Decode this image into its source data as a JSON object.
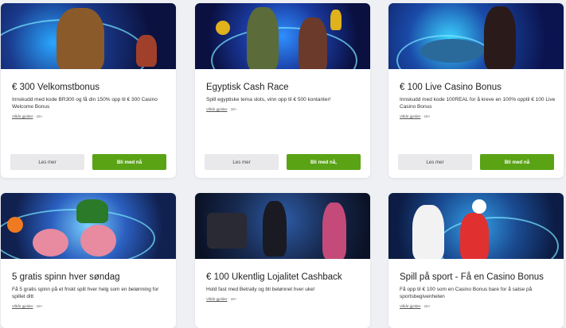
{
  "cards": [
    {
      "title": "€ 300 Velkomstbonus",
      "description": "Innskudd med kode BR300 og få din 150% opp til € 300 Casino Welcome Bonus",
      "terms_link": "Vilkår gjelder",
      "age": "18+",
      "read_more": "Les mer",
      "join": "Bli med nå"
    },
    {
      "title": "Egyptisk Cash Race",
      "description": "Spill egyptiske tema slots, vinn opp til € 500 kontanter!",
      "terms_link": "Vilkår gjelder",
      "age": "18+",
      "read_more": "Les mer",
      "join": "Bli med nå,"
    },
    {
      "title": "€ 100 Live Casino Bonus",
      "description": "Innskudd med kode 100REAL for å kreve en 100% opptil € 100 Live Casino Bonus",
      "terms_link": "Vilkår gjelder",
      "age": "18+",
      "read_more": "Les mer",
      "join": "Bli med nå"
    },
    {
      "title": "5 gratis spinn hver søndag",
      "description": "Få 5 gratis spinn på et friskt spill hver helg som en belønning for spillet ditt",
      "terms_link": "Vilkår gjelder",
      "age": "18+"
    },
    {
      "title": "€ 100 Ukentlig Lojalitet Cashback",
      "description": "Hold fast med Betrally og bli belønnet hver uke!",
      "terms_link": "Vilkår gjelder",
      "age": "18+"
    },
    {
      "title": "Spill på sport - Få en Casino Bonus",
      "description": "Få opp til € 100 som en Casino Bonus bare for å satse på sportsbegivenheten",
      "terms_link": "Vilkår gjelder",
      "age": "18+"
    }
  ]
}
